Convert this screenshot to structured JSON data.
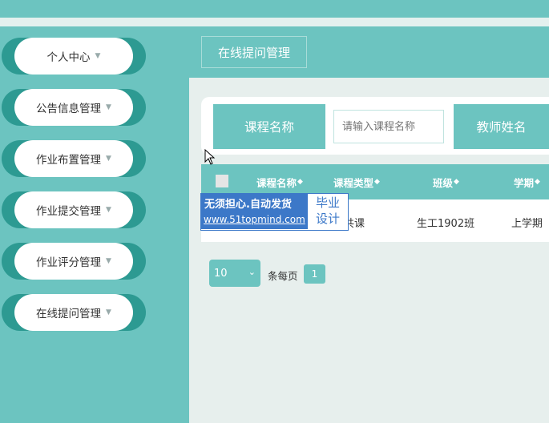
{
  "sidebar": {
    "items": [
      {
        "label": "个人中心"
      },
      {
        "label": "公告信息管理"
      },
      {
        "label": "作业布置管理"
      },
      {
        "label": "作业提交管理"
      },
      {
        "label": "作业评分管理"
      },
      {
        "label": "在线提问管理"
      }
    ]
  },
  "page": {
    "title": "在线提问管理"
  },
  "search": {
    "course_label": "课程名称",
    "course_placeholder": "请输入课程名称",
    "teacher_label": "教师姓名"
  },
  "table": {
    "headers": [
      "课程名称",
      "课程类型",
      "班级",
      "学期"
    ],
    "rows": [
      {
        "course_type_partial": "公共课",
        "class": "生工1902班",
        "term": "上学期"
      }
    ]
  },
  "watermark": {
    "line1": "无须担心.自动发货",
    "line2": "www.51topmind.com",
    "right_line1": "毕业",
    "right_line2": "设计"
  },
  "pagination": {
    "page_size": "10",
    "per_page_label": "条每页",
    "current_page": "1"
  },
  "colors": {
    "accent": "#6cc4c0",
    "accent_dark": "#2d9a92",
    "watermark_blue": "#3c78c8"
  }
}
